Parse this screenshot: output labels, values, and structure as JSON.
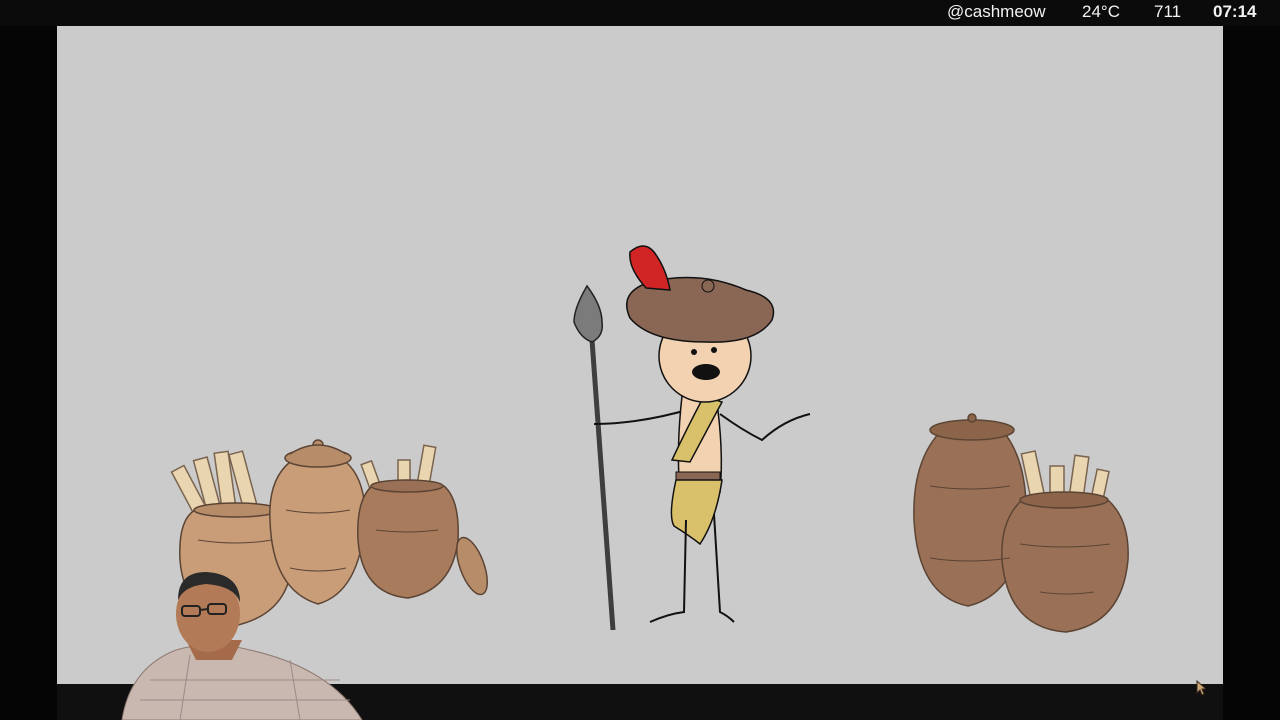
{
  "status_bar": {
    "handle": "@cashmeow",
    "temperature": "24°C",
    "count": "711",
    "time": "07:14"
  },
  "scene": {
    "icons": [
      "scroll-jar-icon",
      "jar-icon",
      "spear-icon",
      "character-icon",
      "webcam-presenter"
    ]
  },
  "colors": {
    "stage_bg": "#cbcbcb",
    "jar_light": "#c89d78",
    "jar_dark": "#9a7156",
    "scroll": "#e9d6b0",
    "hat": "#8a6654",
    "feather": "#d12424",
    "cloth": "#d9c06a"
  }
}
